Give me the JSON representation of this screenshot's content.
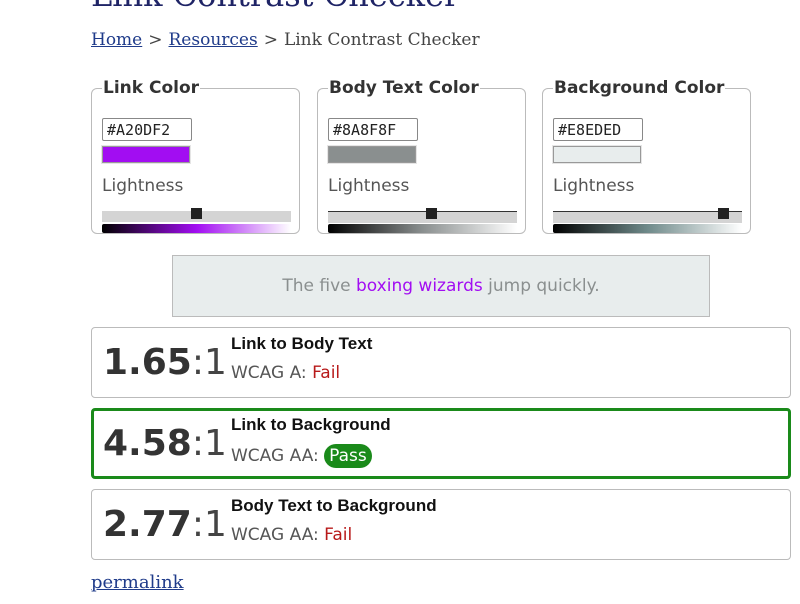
{
  "page": {
    "title": "Link Contrast Checker",
    "breadcrumb": {
      "home": "Home",
      "resources": "Resources",
      "current": "Link Contrast Checker",
      "separator": ">"
    }
  },
  "colors": [
    {
      "legend": "Link Color",
      "hex": "#A20DF2",
      "swatch": "#A20DF2",
      "lightness_label": "Lightness",
      "lightness_fraction": 0.5,
      "gradient": [
        "#000000",
        "#A20DF2",
        "#ffffff"
      ]
    },
    {
      "legend": "Body Text Color",
      "hex": "#8A8F8F",
      "swatch": "#8A8F8F",
      "lightness_label": "Lightness",
      "lightness_fraction": 0.55,
      "gradient": [
        "#000000",
        "#8A8F8F",
        "#ffffff"
      ]
    },
    {
      "legend": "Background Color",
      "hex": "#E8EDED",
      "swatch": "#E8EDED",
      "lightness_label": "Lightness",
      "lightness_fraction": 0.9,
      "gradient": [
        "#000000",
        "#6f8a8a",
        "#ffffff"
      ]
    }
  ],
  "preview": {
    "before": "The five ",
    "link": "boxing wizards",
    "after": " jump quickly."
  },
  "results": [
    {
      "ratio": "1.65",
      "suffix": ":1",
      "title": "Link to Body Text",
      "level": "WCAG A:",
      "status": "Fail",
      "pass": false
    },
    {
      "ratio": "4.58",
      "suffix": ":1",
      "title": "Link to Background",
      "level": "WCAG AA:",
      "status": "Pass",
      "pass": true
    },
    {
      "ratio": "2.77",
      "suffix": ":1",
      "title": "Body Text to Background",
      "level": "WCAG AA:",
      "status": "Fail",
      "pass": false
    }
  ],
  "permalink": "permalink",
  "theme": {
    "pass_color": "#1a8a1a",
    "fail_color": "#b81a1a",
    "link_color": "#1f3b8a"
  }
}
